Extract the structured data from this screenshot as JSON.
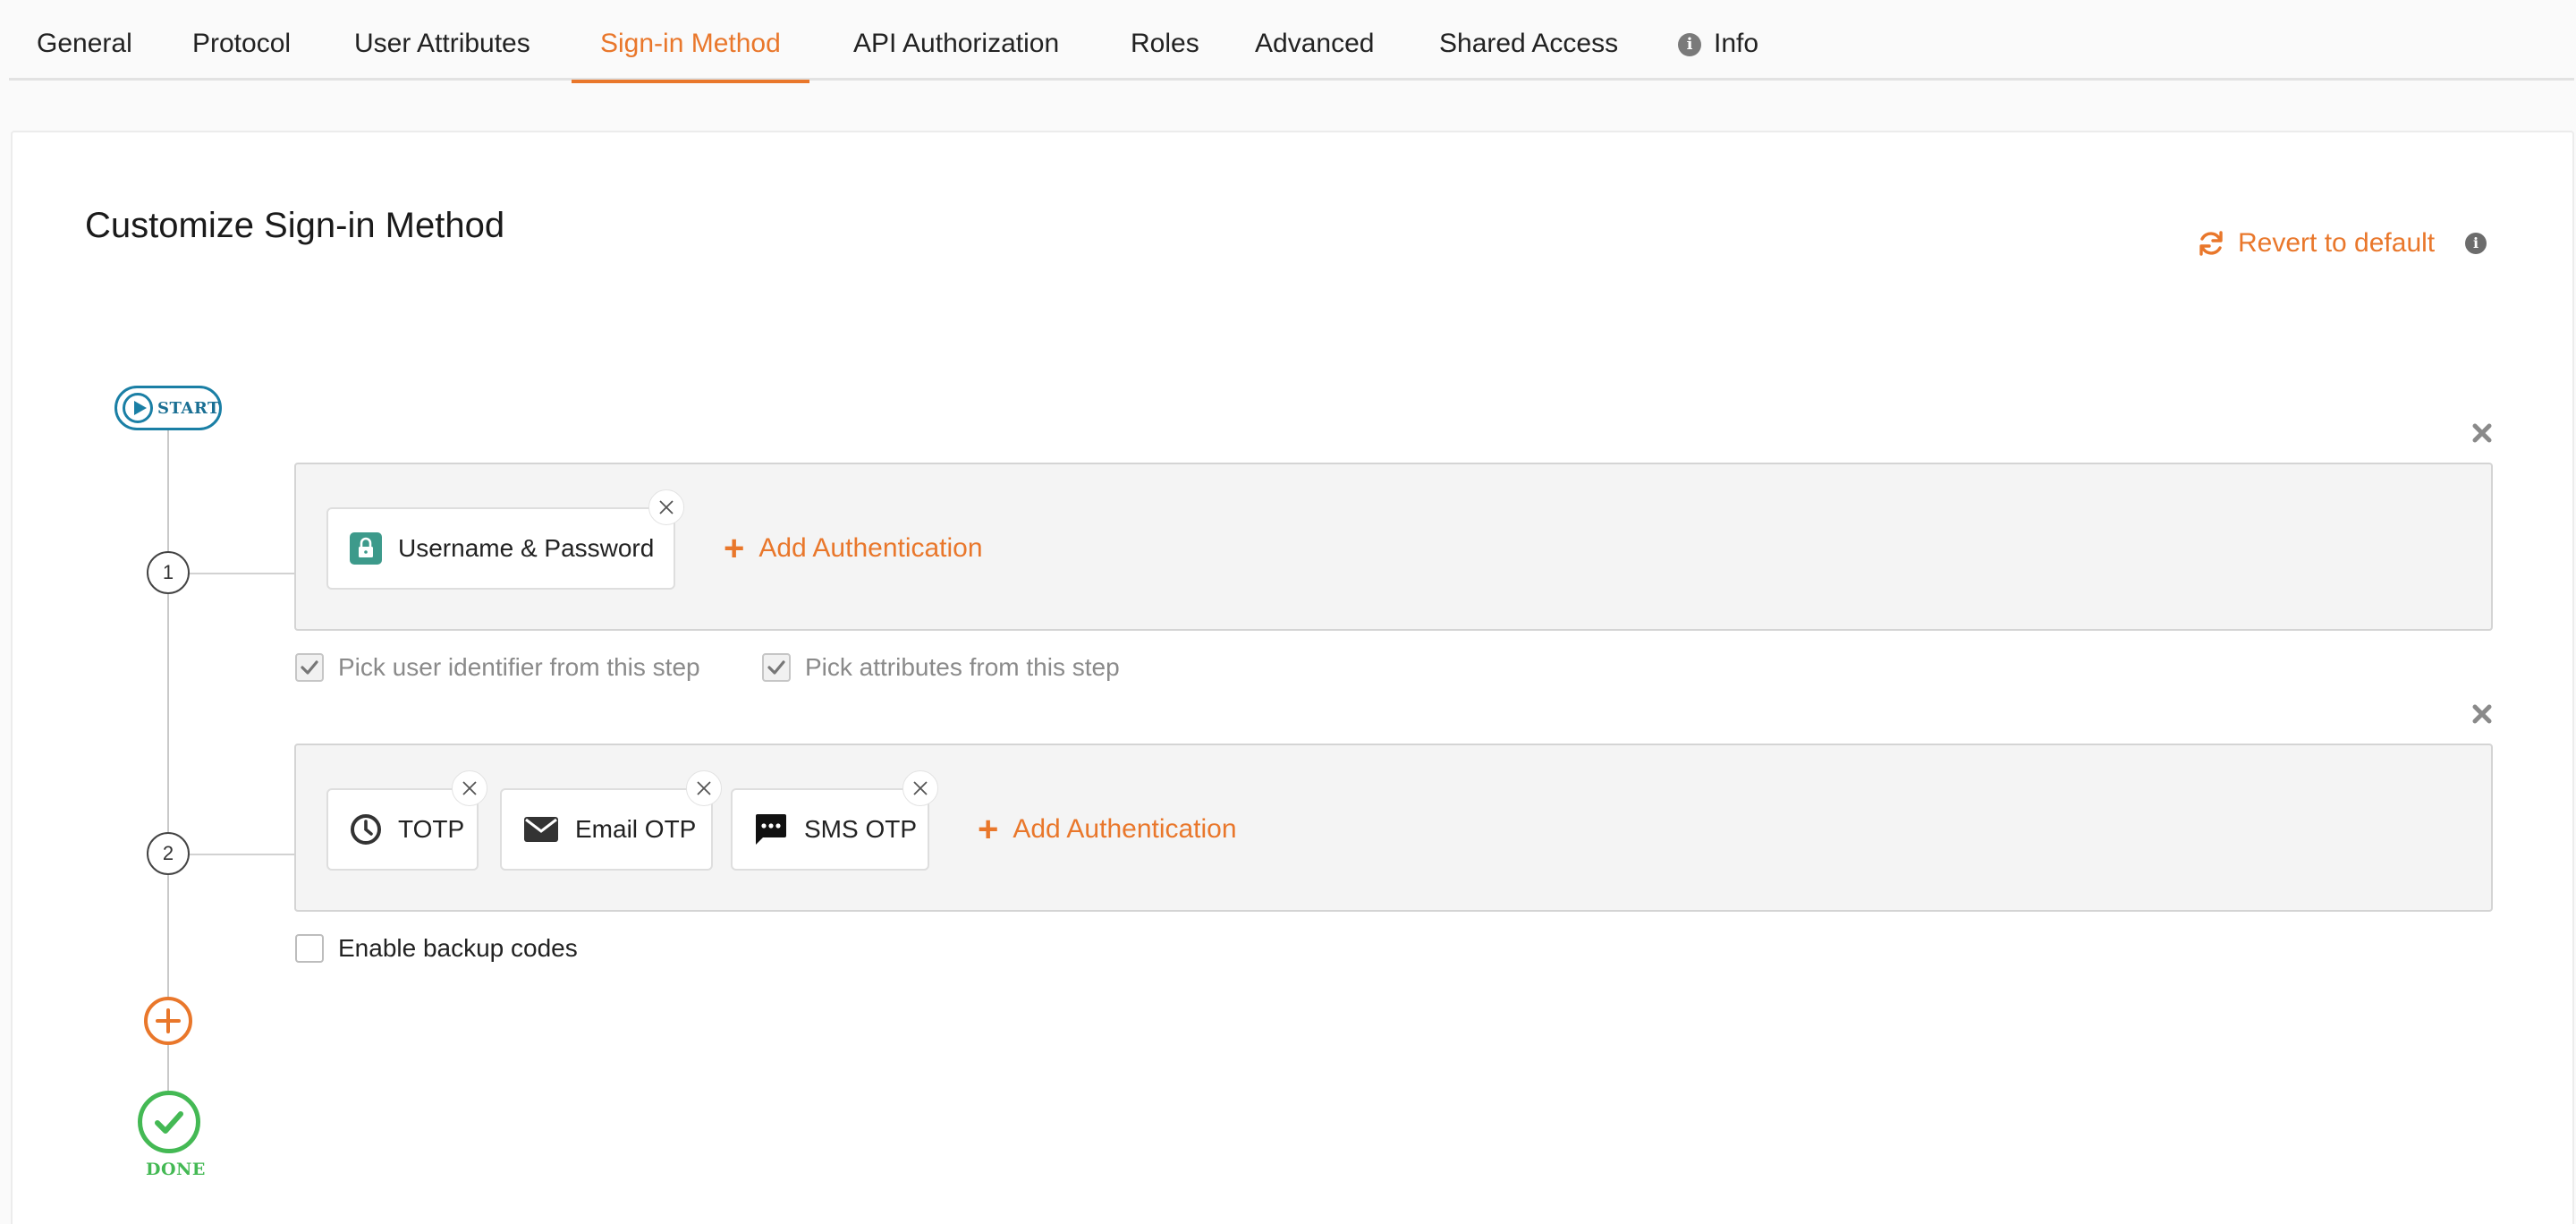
{
  "tabs": [
    {
      "label": "General"
    },
    {
      "label": "Protocol"
    },
    {
      "label": "User Attributes"
    },
    {
      "label": "Sign-in Method",
      "active": true
    },
    {
      "label": "API Authorization"
    },
    {
      "label": "Roles"
    },
    {
      "label": "Advanced"
    },
    {
      "label": "Shared Access"
    },
    {
      "label": "Info",
      "icon": "info-icon"
    }
  ],
  "page": {
    "title": "Customize Sign-in Method",
    "revert_label": "Revert to default"
  },
  "flow": {
    "start_label": "START",
    "done_label": "DONE",
    "steps": [
      {
        "number": "1",
        "authenticators": [
          {
            "label": "Username & Password",
            "icon": "lock-icon"
          }
        ],
        "add_label": "Add Authentication",
        "options": [
          {
            "label": "Pick user identifier from this step",
            "checked": true
          },
          {
            "label": "Pick attributes from this step",
            "checked": true
          }
        ]
      },
      {
        "number": "2",
        "authenticators": [
          {
            "label": "TOTP",
            "icon": "clock-icon"
          },
          {
            "label": "Email OTP",
            "icon": "envelope-icon"
          },
          {
            "label": "SMS OTP",
            "icon": "chat-icon"
          }
        ],
        "add_label": "Add Authentication",
        "options": [
          {
            "label": "Enable backup codes",
            "checked": false
          }
        ]
      }
    ]
  },
  "colors": {
    "accent": "#e9772b",
    "start": "#1a7fa5",
    "done": "#44b954",
    "lock_bg": "#3d9a8b"
  }
}
